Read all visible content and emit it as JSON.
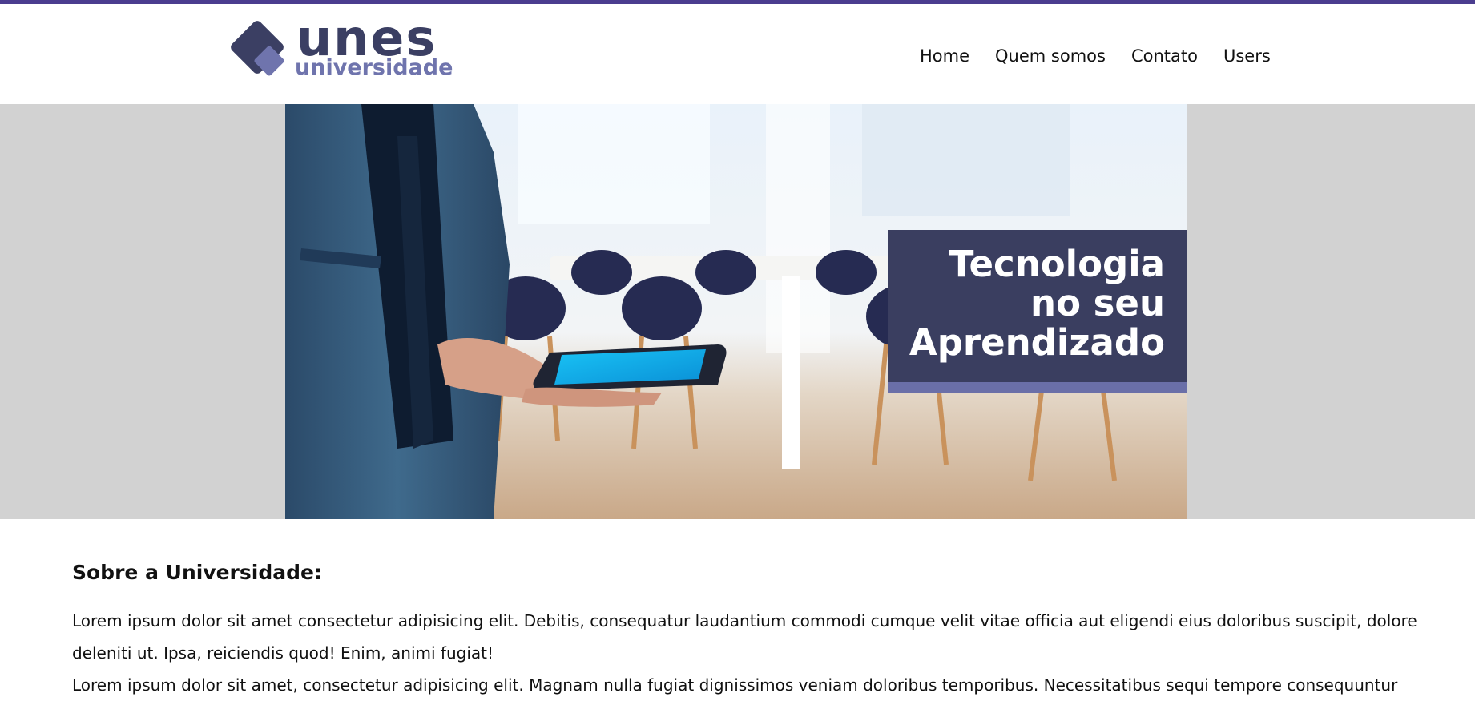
{
  "header": {
    "logo_word": "unes",
    "logo_sub": "universidade",
    "nav": [
      {
        "label": "Home"
      },
      {
        "label": "Quem somos"
      },
      {
        "label": "Contato"
      },
      {
        "label": "Users"
      }
    ]
  },
  "banner": {
    "caption": "Tecnologia\nno seu\nAprendizado"
  },
  "about": {
    "heading": "Sobre a Universidade:",
    "paragraph_1": "Lorem ipsum dolor sit amet consectetur adipisicing elit. Debitis, consequatur laudantium commodi cumque velit vitae officia aut eligendi eius doloribus suscipit, dolore deleniti ut. Ipsa, reiciendis quod! Enim, animi fugiat!",
    "paragraph_2": "Lorem ipsum dolor sit amet, consectetur adipisicing elit. Magnam nulla fugiat dignissimos veniam doloribus temporibus. Necessitatibus sequi tempore consequuntur"
  },
  "colors": {
    "top_bar": "#4b3d8f",
    "brand_dark": "#3b3f63",
    "brand_light": "#6f74ad",
    "banner_bg": "#d2d2d2"
  },
  "icons": {
    "logo_mark": "diamond-logo-icon"
  }
}
